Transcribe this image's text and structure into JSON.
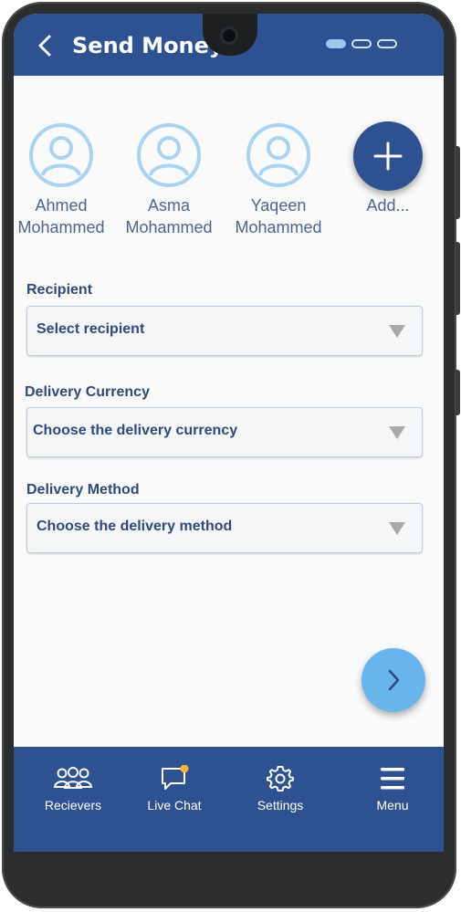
{
  "header": {
    "title": "Send Money",
    "back_icon": "chevron-left-icon"
  },
  "page_indicator": {
    "count": 3,
    "active_index": 0
  },
  "contacts": [
    {
      "first": "Ahmed",
      "last": "Mohammed"
    },
    {
      "first": "Asma",
      "last": "Mohammed"
    },
    {
      "first": "Yaqeen",
      "last": "Mohammed"
    }
  ],
  "add_contact": {
    "label": "Add..."
  },
  "form": {
    "recipient": {
      "label": "Recipient",
      "value": "Select recipient"
    },
    "currency": {
      "label": "Delivery Currency",
      "value": "Choose the delivery currency"
    },
    "method": {
      "label": "Delivery Method",
      "value": "Choose the delivery method"
    }
  },
  "bottom_nav": [
    {
      "label": "Recievers",
      "icon": "users-icon"
    },
    {
      "label": "Live Chat",
      "icon": "chat-icon"
    },
    {
      "label": "Settings",
      "icon": "gear-icon"
    },
    {
      "label": "Menu",
      "icon": "menu-icon"
    }
  ],
  "colors": {
    "primary": "#2e5291",
    "accent": "#67b5ec",
    "avatar": "#a8d3f3",
    "notification": "#f5b730"
  }
}
